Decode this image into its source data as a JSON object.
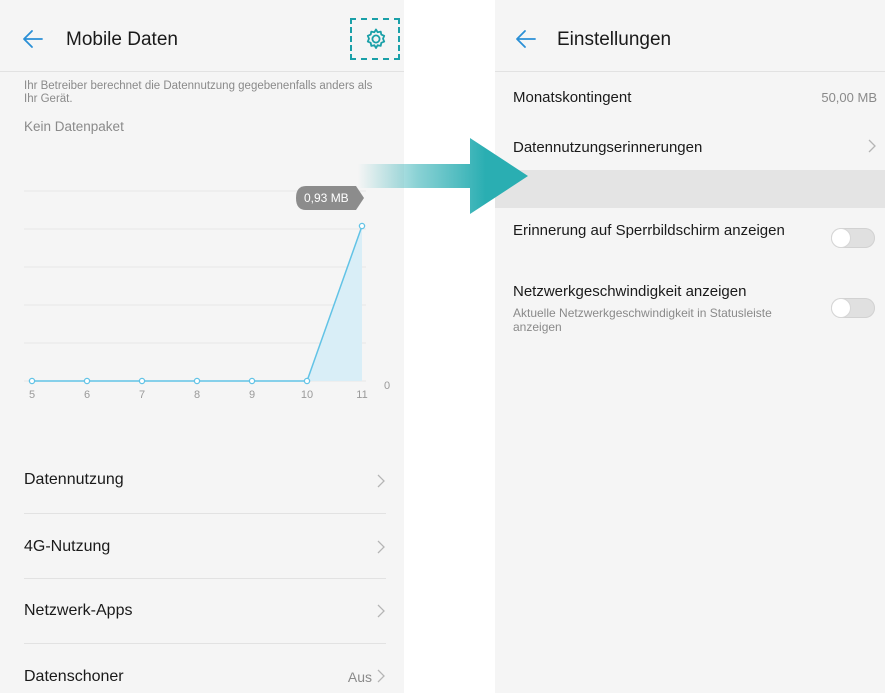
{
  "left": {
    "title": "Mobile Daten",
    "note": "Ihr Betreiber berechnet die Datennutzung gegebenenfalls anders als Ihr Gerät.",
    "plan_label": "Kein Datenpaket",
    "menu": [
      {
        "label": "Datennutzung",
        "value": ""
      },
      {
        "label": "4G-Nutzung",
        "value": ""
      },
      {
        "label": "Netzwerk-Apps",
        "value": ""
      },
      {
        "label": "Datenschoner",
        "value": "Aus"
      }
    ]
  },
  "right": {
    "title": "Einstellungen",
    "rows": [
      {
        "label": "Monatskontingent",
        "value": "50,00 MB"
      },
      {
        "label": "Datennutzungserinnerungen",
        "value": ""
      }
    ],
    "toggles": [
      {
        "label": "Erinnerung auf Sperrbildschirm anzeigen",
        "sublabel": "",
        "on": false
      },
      {
        "label": "Netzwerkgeschwindigkeit anzeigen",
        "sublabel": "Aktuelle Netzwerkgeschwindigkeit in Statusleiste anzeigen",
        "on": false
      }
    ]
  },
  "icons": {
    "back": "back-arrow-icon",
    "settings": "gear-icon",
    "chevron": "chevron-right-icon",
    "flow": "arrow-right-icon"
  },
  "colors": {
    "accent": "#1aa0a8",
    "chart_line": "#62c3e6",
    "chart_fill": "#d9eef7",
    "callout": "#8c8c8c"
  },
  "chart_data": {
    "type": "area",
    "x": [
      "5",
      "6",
      "7",
      "8",
      "9",
      "10",
      "11"
    ],
    "values": [
      0,
      0,
      0,
      0,
      0,
      0,
      0.93
    ],
    "y_tick_label": "0",
    "peak_label": "0,93 MB",
    "ylim": [
      0,
      1.2
    ],
    "grid": true
  }
}
